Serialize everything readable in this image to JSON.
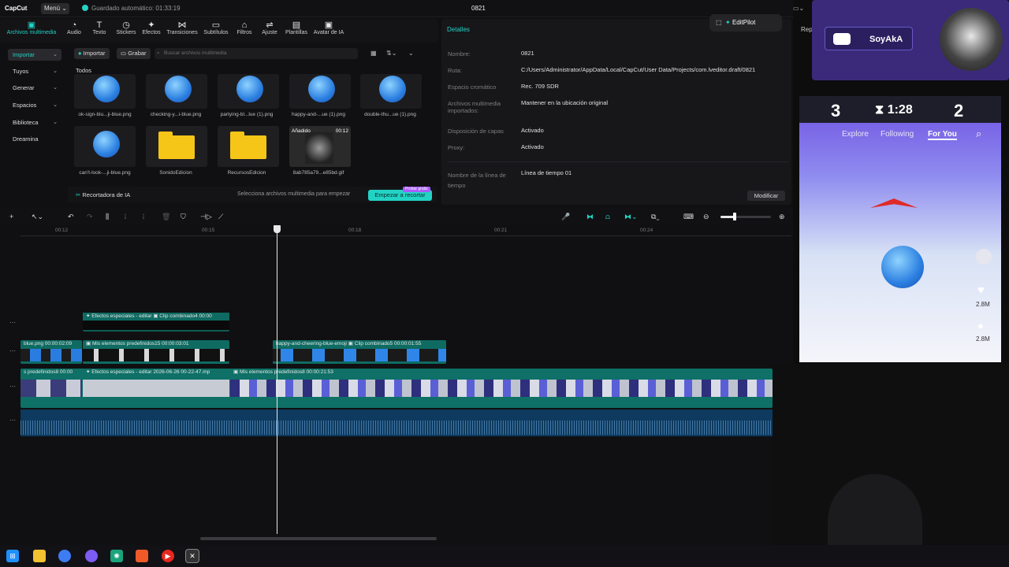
{
  "window": {
    "app_name": "CapCut",
    "menu_label": "Menú",
    "autosave": "Guardado automático: 01:33:19",
    "project": "0821"
  },
  "toolbar": [
    {
      "label": "Archivos multimedia",
      "icon": "media-icon"
    },
    {
      "label": "Audio",
      "icon": "audio-icon"
    },
    {
      "label": "Texto",
      "icon": "text-icon"
    },
    {
      "label": "Stickers",
      "icon": "stickers-icon"
    },
    {
      "label": "Efectos",
      "icon": "effects-icon"
    },
    {
      "label": "Transiciones",
      "icon": "transitions-icon"
    },
    {
      "label": "Subtítulos",
      "icon": "subtitles-icon"
    },
    {
      "label": "Filtros",
      "icon": "filters-icon"
    },
    {
      "label": "Ajuste",
      "icon": "adjust-icon"
    },
    {
      "label": "Plantillas",
      "icon": "templates-icon"
    },
    {
      "label": "Avatar de IA",
      "icon": "avatar-icon"
    }
  ],
  "sidebar": [
    {
      "label": "Importar"
    },
    {
      "label": "Tuyos"
    },
    {
      "label": "Generar"
    },
    {
      "label": "Espacios"
    },
    {
      "label": "Biblioteca"
    },
    {
      "label": "Dreamina"
    }
  ],
  "media": {
    "import_label": "Importar",
    "record_label": "Grabar",
    "search_placeholder": "Buscar archivos multimedia",
    "filter_label": "Todos",
    "items": [
      {
        "name": "ok-sign-blu...ji-blue.png"
      },
      {
        "name": "checking-y...i-blue.png"
      },
      {
        "name": "partying-bl...lue (1).png"
      },
      {
        "name": "happy-and-...ue (1).png"
      },
      {
        "name": "double-thu...ue (1).png"
      },
      {
        "name": "can't-look-...ji-blue.png"
      },
      {
        "name": "SonidoEdicion"
      },
      {
        "name": "RecursosEdicion"
      },
      {
        "name": "8ab785a79...e85bd.gif",
        "badge": "Añadido",
        "duration": "00:12"
      }
    ],
    "ai_label": "Recortadora de IA",
    "ai_hint": "Selecciona archivos multimedia para empezar",
    "ai_button": "Empezar a recortar",
    "ai_promo": "Probar gratis"
  },
  "details": {
    "header": "Detalles",
    "editpilot": "EditPilot",
    "rows": [
      {
        "label": "Nombre:",
        "value": "0821"
      },
      {
        "label": "Ruta:",
        "value": "C:/Users/Administrator/AppData/Local/CapCut/User Data/Projects/com.lveditor.draft/0821"
      },
      {
        "label": "Espacio cromático",
        "value": "Rec. 709 SDR"
      },
      {
        "label": "Archivos multimedia importados:",
        "value": "Mantener en la ubicación original"
      },
      {
        "label": "Disposición de capas",
        "value": "Activado"
      },
      {
        "label": "Proxy:",
        "value": "Activado"
      },
      {
        "label": "Nombre de la línea de tiempo",
        "value": "Línea de tiempo 01"
      }
    ],
    "modify_button": "Modificar"
  },
  "ruler": [
    "00:12",
    "00:15",
    "00:18",
    "00:21",
    "00:24"
  ],
  "clips": {
    "fx1": "Efectos especiales - editar",
    "combined4": "Clip combinado4",
    "combined4_time": "00:00",
    "blue_png": "blue.png",
    "blue_time": "00:00:02:09",
    "preset15": "Mis elementos predefinidos15",
    "preset15_time": "00:00:03:01",
    "happy": "happy-and-cheering-blue-emoji",
    "combined5": "Clip combinado5",
    "combined5_time": "00:00:01:55",
    "preset8a": "s predefinidos8",
    "preset8a_time": "00:00",
    "fx2": "Efectos especiales - editar",
    "date_clip": "2026-06-26 00-22-47.mp",
    "preset8b": "Mis elementos predefinidos8",
    "preset8b_time": "00:00:21:53"
  },
  "overlay": {
    "channel": "SoyAkA",
    "rep": "Rep"
  },
  "phone": {
    "score_left": "3",
    "timer": "1:28",
    "score_right": "2",
    "tab_explore": "Explore",
    "tab_following": "Following",
    "tab_foryou": "For You",
    "likes": "2.8M",
    "comments": "2.8M"
  }
}
